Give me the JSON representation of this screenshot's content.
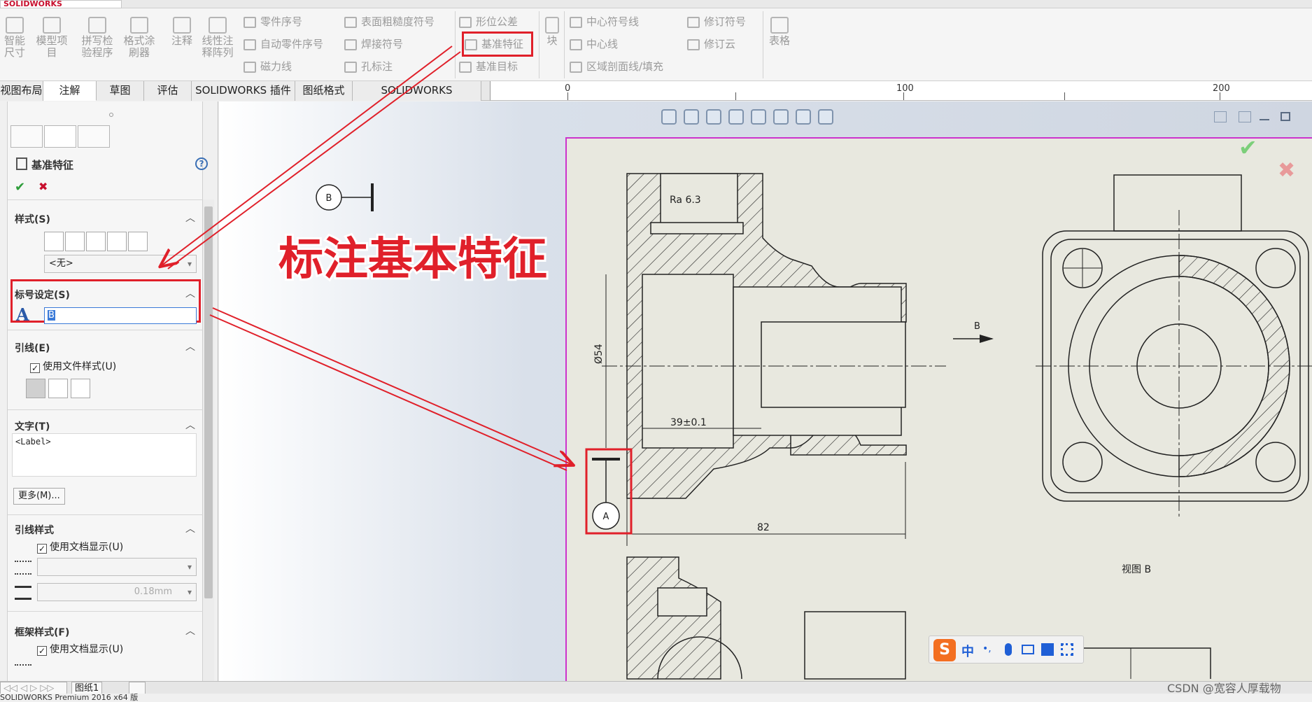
{
  "app": {
    "logo_text": "SOLIDWORKS",
    "status_text": "SOLIDWORKS Premium 2016 x64 版"
  },
  "ribbon": {
    "left_buttons": [
      {
        "label": "智能尺寸",
        "icon": "smart-dimension-icon"
      },
      {
        "label": "模型项目",
        "icon": "model-items-icon"
      },
      {
        "label": "拼写检验程序",
        "icon": "spell-check-icon"
      },
      {
        "label": "格式涂刷器",
        "icon": "format-painter-icon"
      },
      {
        "label": "注释",
        "icon": "note-icon"
      },
      {
        "label": "线性注释阵列",
        "icon": "linear-note-pattern-icon"
      }
    ],
    "col1": [
      "零件序号",
      "自动零件序号",
      "磁力线"
    ],
    "col2": [
      "表面粗糙度符号",
      "焊接符号",
      "孔标注"
    ],
    "col3": [
      "形位公差",
      "基准特征",
      "基准目标"
    ],
    "block_label": "块",
    "col4": [
      "中心符号线",
      "中心线",
      "区域剖面线/填充"
    ],
    "col5": [
      "修订符号",
      "修订云"
    ],
    "table_label": "表格",
    "highlighted": "基准特征"
  },
  "tabs": [
    "视图布局",
    "注解",
    "草图",
    "评估",
    "SOLIDWORKS 插件",
    "图纸格式",
    "SOLIDWORKS Inspection"
  ],
  "active_tab": "注解",
  "ruler": {
    "labels": [
      "0",
      "100",
      "200"
    ]
  },
  "panel": {
    "title": "基准特征",
    "help": "?",
    "ok": "✔",
    "cancel": "✖",
    "style_title": "样式(S)",
    "style_dropdown": "<无>",
    "label_settings_title": "标号设定(S)",
    "label_value": "B",
    "leader_title": "引线(E)",
    "use_doc_style": "使用文件样式(U)",
    "text_title": "文字(T)",
    "text_value": "<Label>",
    "more_button": "更多(M)...",
    "leader_style_title": "引线样式",
    "use_doc_display": "使用文档显示(U)",
    "line_weight": "0.18mm",
    "frame_style_title": "框架样式(F)",
    "frame_use_doc_display": "使用文档显示(U)"
  },
  "annotation": {
    "headline": "标注基本特征"
  },
  "drawing": {
    "datum_b_symbol": "B",
    "datum_a_symbol": "A",
    "roughness": "Ra 6.3",
    "dim_diameter": "Ø54",
    "dim_length": "39±0.1",
    "dim_overall": "82",
    "arrow_label": "B",
    "view_label": "视图 B"
  },
  "sheet_tabs": {
    "sheet": "图纸1"
  },
  "ime": {
    "logo": "S",
    "mode": "中",
    "punct": "•,"
  },
  "watermark": "CSDN @宽容人厚载物",
  "colors": {
    "highlight": "#e0202a",
    "sheet_border": "#cc33cc",
    "ok": "#2e9d3a",
    "cancel": "#c8102e"
  }
}
